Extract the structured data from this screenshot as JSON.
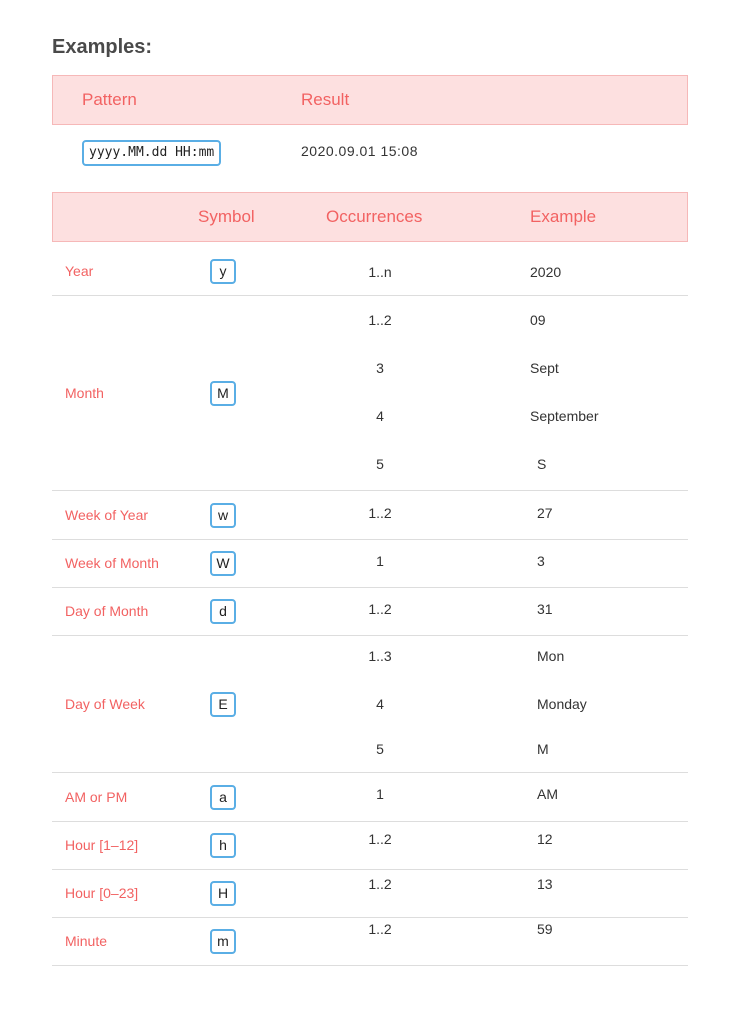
{
  "heading": "Examples:",
  "example_table": {
    "headers": [
      "Pattern",
      "Result"
    ],
    "pattern": "yyyy.MM.dd HH:mm",
    "result": "2020.09.01 15:08"
  },
  "symbols_table": {
    "headers": [
      "",
      "Symbol",
      "Occurrences",
      "Example"
    ],
    "rows": [
      {
        "label": "Year",
        "symbol": "y",
        "entries": [
          {
            "occ": "1..n",
            "ex": "2020"
          }
        ]
      },
      {
        "label": "Month",
        "symbol": "M",
        "entries": [
          {
            "occ": "1..2",
            "ex": "09"
          },
          {
            "occ": "3",
            "ex": "Sept"
          },
          {
            "occ": "4",
            "ex": "September"
          },
          {
            "occ": "5",
            "ex": "S"
          }
        ]
      },
      {
        "label": "Week of Year",
        "symbol": "w",
        "entries": [
          {
            "occ": "1..2",
            "ex": "27"
          }
        ]
      },
      {
        "label": "Week of Month",
        "symbol": "W",
        "entries": [
          {
            "occ": "1",
            "ex": "3"
          }
        ]
      },
      {
        "label": "Day of Month",
        "symbol": "d",
        "entries": [
          {
            "occ": "1..2",
            "ex": "31"
          }
        ]
      },
      {
        "label": "Day of Week",
        "symbol": "E",
        "entries": [
          {
            "occ": "1..3",
            "ex": "Mon"
          },
          {
            "occ": "4",
            "ex": "Monday"
          },
          {
            "occ": "5",
            "ex": "M"
          }
        ]
      },
      {
        "label": "AM or PM",
        "symbol": "a",
        "entries": [
          {
            "occ": "1",
            "ex": "AM"
          }
        ]
      },
      {
        "label": "Hour [1–12]",
        "symbol": "h",
        "entries": [
          {
            "occ": "1..2",
            "ex": "12"
          }
        ]
      },
      {
        "label": "Hour [0–23]",
        "symbol": "H",
        "entries": [
          {
            "occ": "1..2",
            "ex": "13"
          }
        ]
      },
      {
        "label": "Minute",
        "symbol": "m",
        "entries": [
          {
            "occ": "1..2",
            "ex": "59"
          }
        ]
      }
    ]
  },
  "colors": {
    "accent": "#f26262",
    "header_bg": "#fde0e0",
    "code_border": "#5aaee5"
  }
}
